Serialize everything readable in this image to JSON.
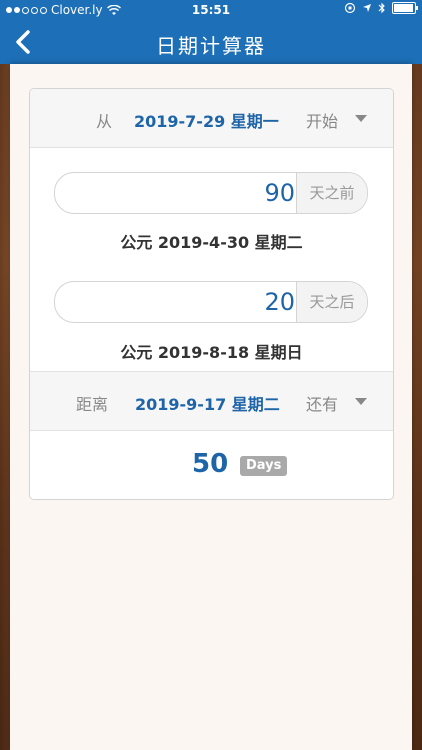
{
  "status_bar": {
    "carrier": "Clover.ly",
    "time": "15:51",
    "battery_level": 0.95
  },
  "nav": {
    "title": "日期计算器",
    "back_icon": "chevron-left-icon"
  },
  "from_row": {
    "label": "从",
    "date": "2019-7-29 星期一",
    "mode": "开始"
  },
  "before": {
    "value": "90",
    "suffix": "天之前",
    "result": "公元 2019-4-30 星期二"
  },
  "after": {
    "value": "20",
    "suffix": "天之后",
    "result": "公元 2019-8-18 星期日"
  },
  "distance_row": {
    "label": "距离",
    "date": "2019-9-17 星期二",
    "mode": "还有"
  },
  "distance_result": {
    "value": "50",
    "unit": "Days"
  },
  "colors": {
    "accent": "#1d6fb7",
    "date_text": "#1e64a8",
    "wood": "#7a4424"
  }
}
